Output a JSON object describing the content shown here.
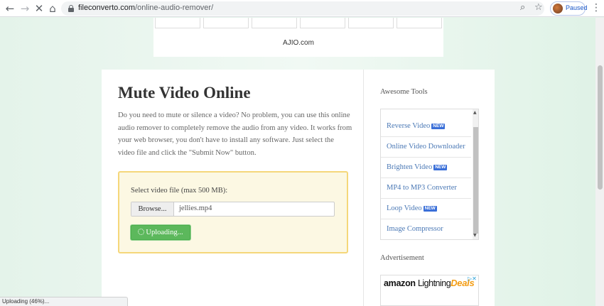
{
  "browser": {
    "url_host": "fileconverto.com",
    "url_path": "/online-audio-remover/",
    "profile_label": "Paused",
    "nav_icons": [
      "back-icon",
      "forward-icon",
      "stop-icon",
      "home-icon"
    ],
    "omnibox_icons": [
      "zoom-icon",
      "star-icon"
    ]
  },
  "top_ad": {
    "brand": "AJIO.com"
  },
  "main": {
    "title": "Mute Video Online",
    "intro": "Do you need to mute or silence a video? No problem, you can use this online audio remover to completely remove the audio from any video. It works from your web browser, you don't have to install any software. Just select the video file and click the \"Submit Now\" button.",
    "upload": {
      "label": "Select video file (max 500 MB):",
      "browse_label": "Browse...",
      "file_name": "jellies.mp4",
      "button_label": "Uploading..."
    }
  },
  "sidebar": {
    "heading": "Awesome Tools",
    "tools": [
      {
        "label": "Reverse Video",
        "badge": "NEW"
      },
      {
        "label": "Online Video Downloader",
        "badge": ""
      },
      {
        "label": "Brighten Video",
        "badge": "NEW"
      },
      {
        "label": "MP4 to MP3 Converter",
        "badge": ""
      },
      {
        "label": "Loop Video",
        "badge": "NEW"
      },
      {
        "label": "Image Compressor",
        "badge": ""
      }
    ],
    "ad_heading": "Advertisement",
    "ad": {
      "brand_a": "amazon",
      "brand_b": "Lightning",
      "brand_c": "Deals",
      "choice": "▷✕"
    }
  },
  "status_text": "Uploading (46%)...",
  "colors": {
    "accent_green": "#5cb85c",
    "link_blue": "#4a78b5",
    "badge_blue": "#3a6fd8",
    "upload_bg": "#fcf8e3",
    "upload_border": "#f5d77a"
  }
}
